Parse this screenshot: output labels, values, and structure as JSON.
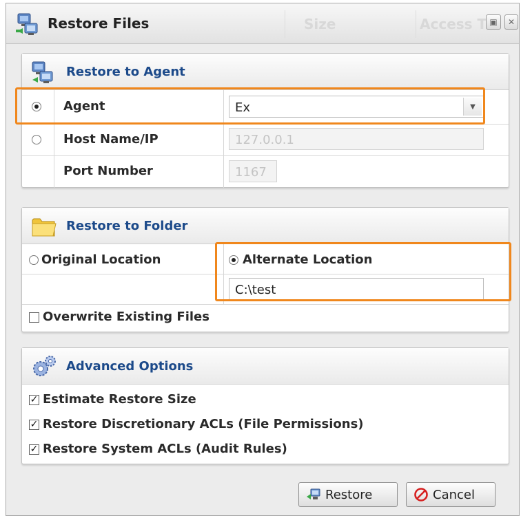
{
  "dialog": {
    "title": "Restore Files",
    "background_columns": [
      "Size",
      "Access T"
    ],
    "window_buttons": [
      "maximize",
      "close"
    ]
  },
  "restore_to_agent": {
    "title": "Restore to Agent",
    "rows": [
      {
        "label": "Agent",
        "selected": true,
        "value": "Ex",
        "control": "dropdown"
      },
      {
        "label": "Host Name/IP",
        "selected": false,
        "value": "127.0.0.1",
        "control": "text-disabled"
      },
      {
        "label": "Port Number",
        "value": "1167",
        "control": "text-disabled"
      }
    ]
  },
  "restore_to_folder": {
    "title": "Restore to Folder",
    "original_location_label": "Original Location",
    "original_location_selected": false,
    "alternate_location_label": "Alternate Location",
    "alternate_location_selected": true,
    "alternate_path": "C:\\test",
    "overwrite_label": "Overwrite Existing Files",
    "overwrite_checked": false
  },
  "advanced_options": {
    "title": "Advanced Options",
    "options": [
      {
        "label": "Estimate Restore Size",
        "checked": true
      },
      {
        "label": "Restore Discretionary ACLs (File Permissions)",
        "checked": true
      },
      {
        "label": "Restore System ACLs (Audit Rules)",
        "checked": true
      }
    ]
  },
  "buttons": {
    "restore_label": "Restore",
    "cancel_label": "Cancel"
  },
  "icons": {
    "title": "network-computers-icon",
    "agent_section": "network-computers-icon",
    "folder_section": "folder-icon",
    "advanced_section": "gears-icon",
    "restore_button": "restore-icon",
    "cancel_button": "cancel-icon"
  },
  "colors": {
    "section_title": "#1c4a8a",
    "highlight": "#f0871c",
    "cancel_red": "#d62020"
  }
}
